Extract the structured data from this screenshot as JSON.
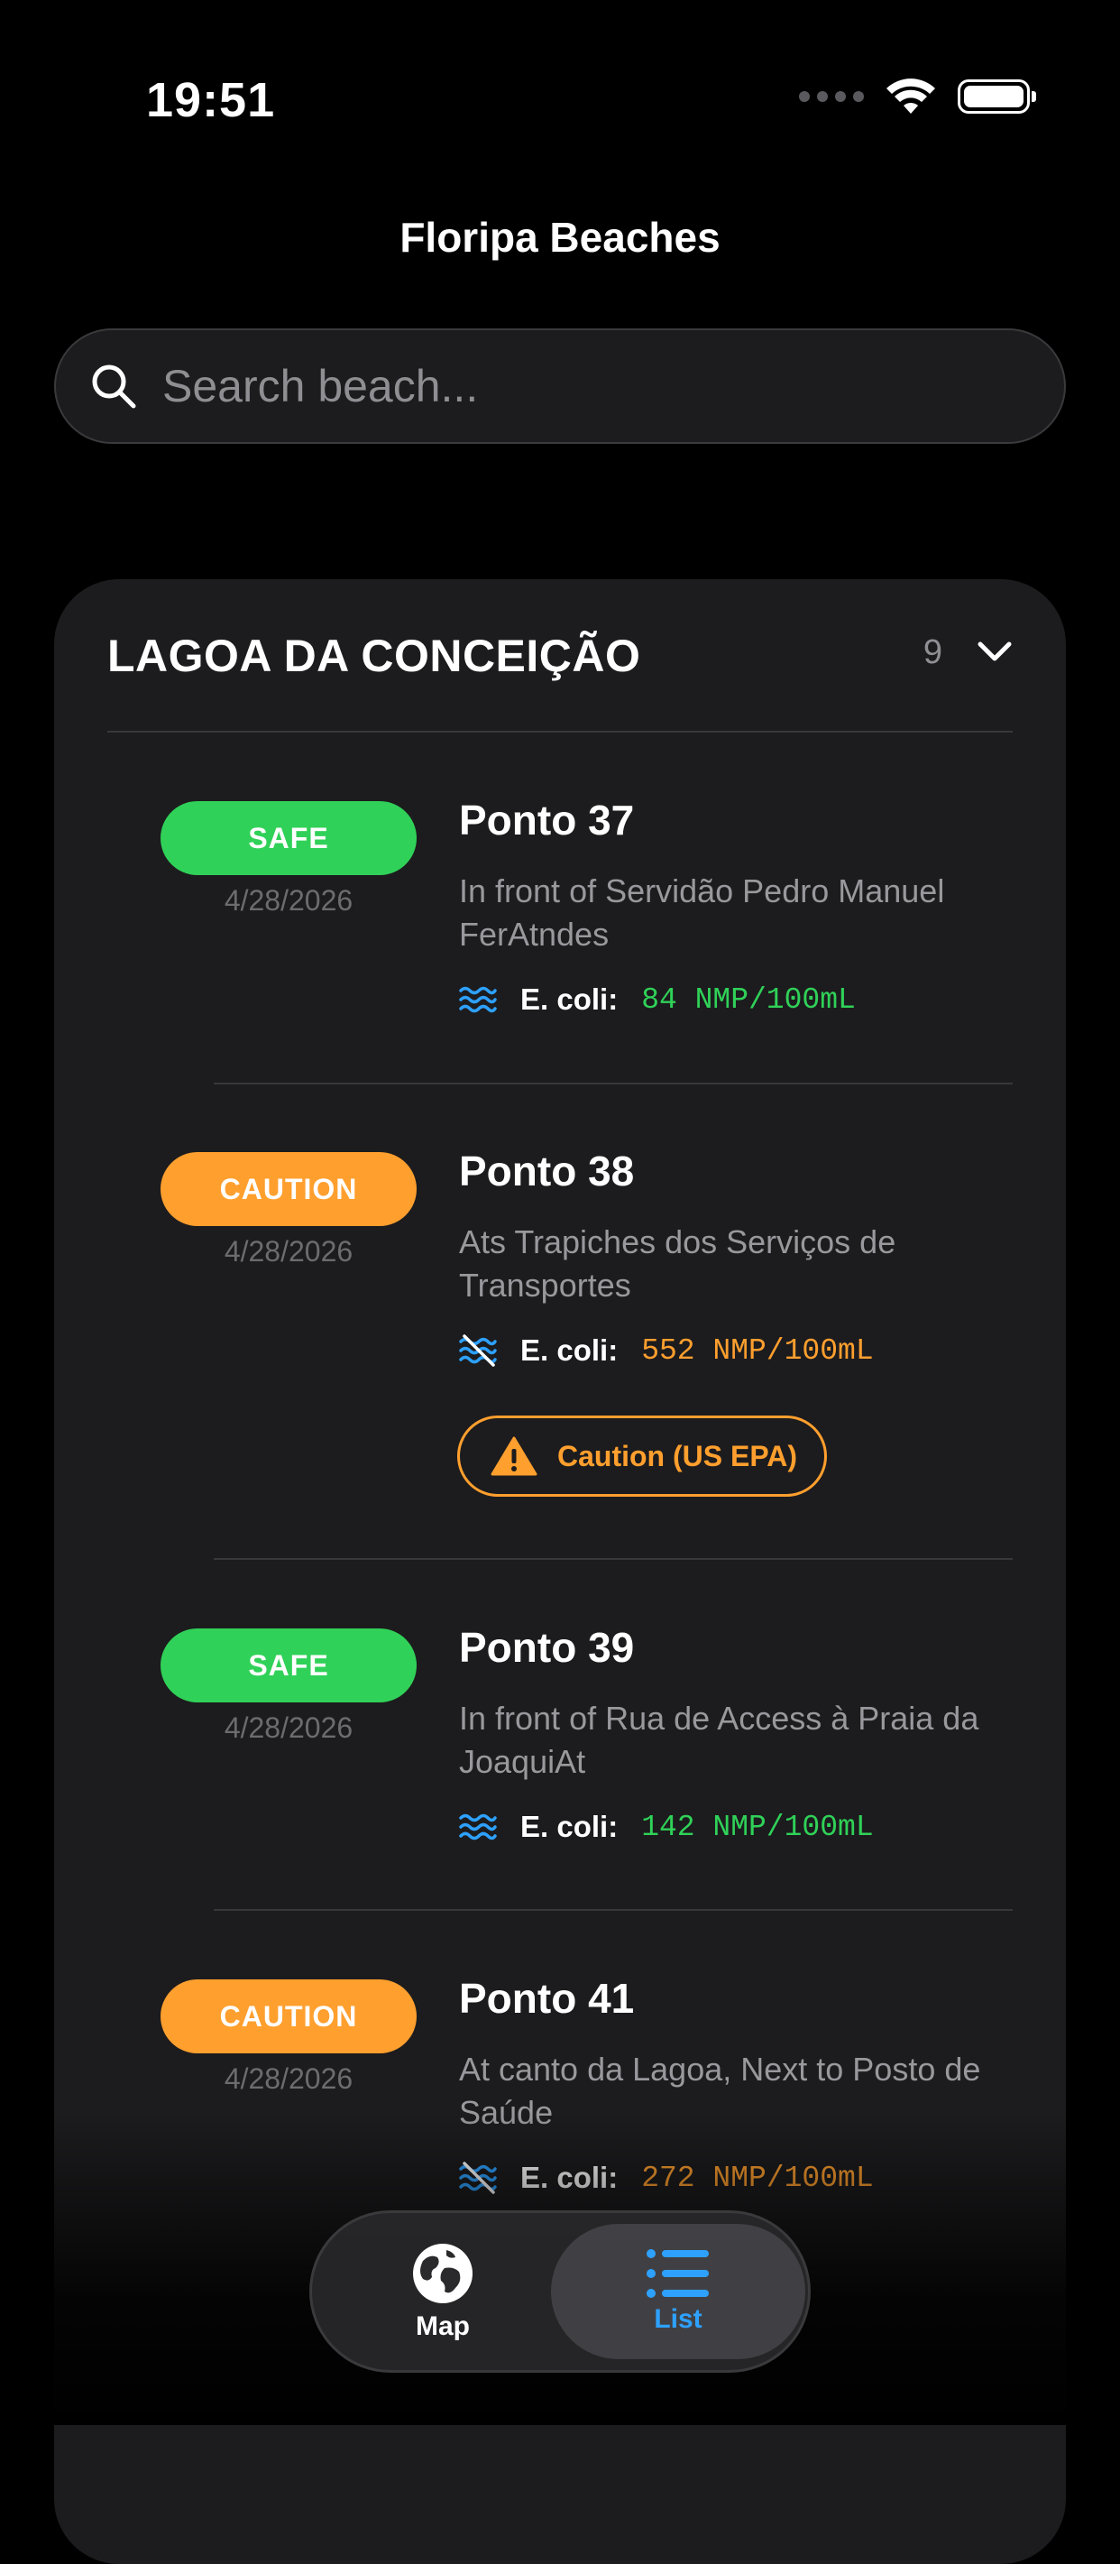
{
  "status_bar": {
    "time": "19:51"
  },
  "header": {
    "title": "Floripa Beaches"
  },
  "search": {
    "placeholder": "Search beach..."
  },
  "section": {
    "title": "LAGOA DA CONCEIÇÃO",
    "count": "9"
  },
  "entries": [
    {
      "status": "SAFE",
      "date": "4/28/2026",
      "name": "Ponto 37",
      "description": "In front of Servidão Pedro Manuel FerAtndes",
      "ecoli_label": "E. coli:",
      "ecoli_value": "84 NMP/100mL"
    },
    {
      "status": "CAUTION",
      "date": "4/28/2026",
      "name": "Ponto 38",
      "description": "Ats Trapiches dos Serviços de Transportes",
      "ecoli_label": "E. coli:",
      "ecoli_value": "552 NMP/100mL",
      "warning": "Caution (US EPA)"
    },
    {
      "status": "SAFE",
      "date": "4/28/2026",
      "name": "Ponto 39",
      "description": "In front of Rua de Access à Praia da JoaquiAt",
      "ecoli_label": "E. coli:",
      "ecoli_value": "142 NMP/100mL"
    },
    {
      "status": "CAUTION",
      "date": "4/28/2026",
      "name": "Ponto 41",
      "description": "At canto da Lagoa, Next to Posto de Saúde",
      "ecoli_label": "E. coli:",
      "ecoli_value": "272 NMP/100mL"
    }
  ],
  "tab_bar": {
    "map_label": "Map",
    "list_label": "List"
  },
  "colors": {
    "safe": "#30d158",
    "caution": "#ff9f2e",
    "accent": "#2ea1ff",
    "card": "#1c1c1e"
  }
}
